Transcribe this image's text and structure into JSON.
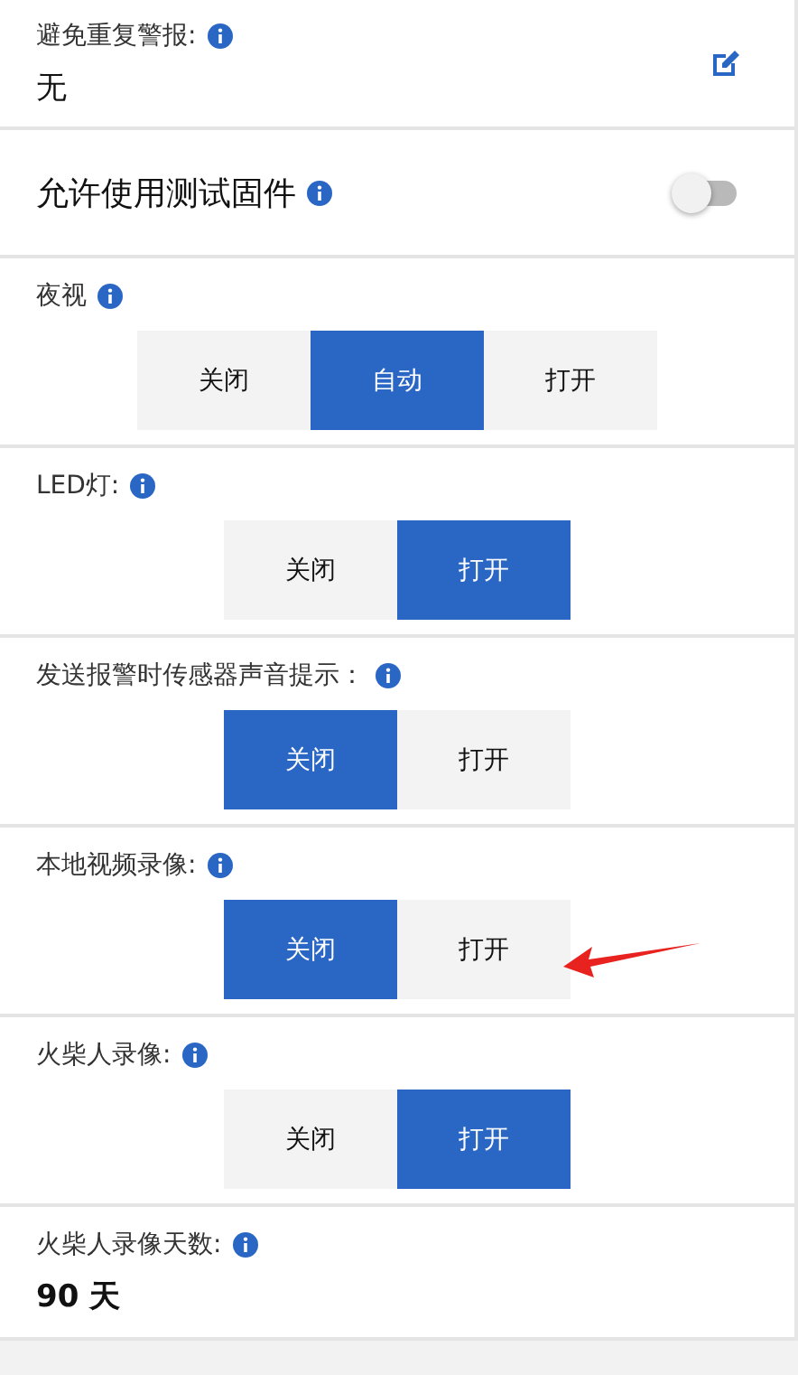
{
  "settings": [
    {
      "kind": "value",
      "label": "避免重复警报:",
      "value": "无",
      "editable": true
    },
    {
      "kind": "toggle",
      "label": "允许使用测试固件",
      "on": false
    },
    {
      "kind": "segmented",
      "label": "夜视",
      "annotated": false,
      "options": [
        {
          "label": "关闭",
          "selected": false
        },
        {
          "label": "自动",
          "selected": true
        },
        {
          "label": "打开",
          "selected": false
        }
      ]
    },
    {
      "kind": "segmented",
      "label": "LED灯:",
      "annotated": false,
      "options": [
        {
          "label": "关闭",
          "selected": false
        },
        {
          "label": "打开",
          "selected": true
        }
      ]
    },
    {
      "kind": "segmented",
      "label": "发送报警时传感器声音提示：",
      "annotated": false,
      "options": [
        {
          "label": "关闭",
          "selected": true
        },
        {
          "label": "打开",
          "selected": false
        }
      ]
    },
    {
      "kind": "segmented",
      "label": "本地视频录像:",
      "annotated": true,
      "options": [
        {
          "label": "关闭",
          "selected": true
        },
        {
          "label": "打开",
          "selected": false
        }
      ]
    },
    {
      "kind": "segmented",
      "label": "火柴人录像:",
      "annotated": false,
      "options": [
        {
          "label": "关闭",
          "selected": false
        },
        {
          "label": "打开",
          "selected": true
        }
      ]
    },
    {
      "kind": "value",
      "label": "火柴人录像天数:",
      "value": "90 天",
      "editable": false
    }
  ]
}
